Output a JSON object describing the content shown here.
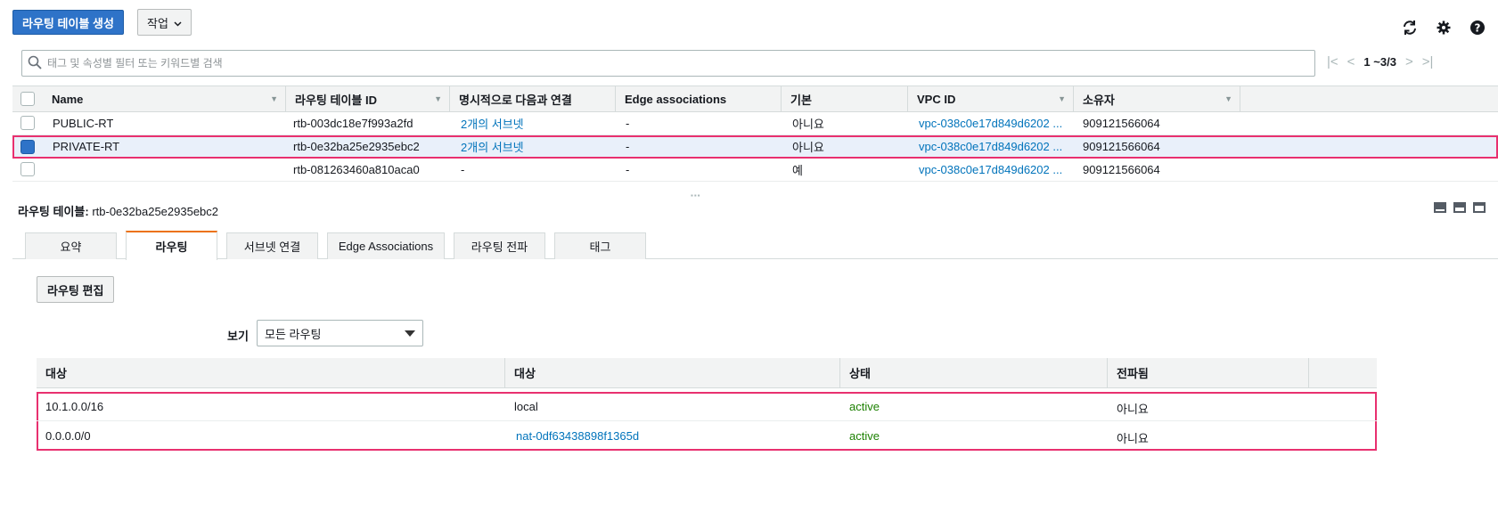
{
  "toolbar": {
    "create_label": "라우팅 테이블 생성",
    "actions_label": "작업"
  },
  "search": {
    "placeholder": "태그 및 속성별 필터 또는 키워드별 검색"
  },
  "pager": {
    "text": "1 ~3/3"
  },
  "route_tables": {
    "columns": [
      "Name",
      "라우팅 테이블 ID",
      "명시적으로 다음과 연결",
      "Edge associations",
      "기본",
      "VPC ID",
      "소유자"
    ],
    "rows": [
      {
        "name": "PUBLIC-RT",
        "id": "rtb-003dc18e7f993a2fd",
        "explicit": "2개의 서브넷",
        "edge": "-",
        "main": "아니요",
        "vpc": "vpc-038c0e17d849d6202 ...",
        "owner": "909121566064",
        "selected": false
      },
      {
        "name": "PRIVATE-RT",
        "id": "rtb-0e32ba25e2935ebc2",
        "explicit": "2개의 서브넷",
        "edge": "-",
        "main": "아니요",
        "vpc": "vpc-038c0e17d849d6202 ...",
        "owner": "909121566064",
        "selected": true
      },
      {
        "name": "",
        "id": "rtb-081263460a810aca0",
        "explicit": "-",
        "edge": "-",
        "main": "예",
        "vpc": "vpc-038c0e17d849d6202 ...",
        "owner": "909121566064",
        "selected": false
      }
    ]
  },
  "detail": {
    "label": "라우팅 테이블:",
    "id": "rtb-0e32ba25e2935ebc2"
  },
  "tabs": [
    "요약",
    "라우팅",
    "서브넷 연결",
    "Edge Associations",
    "라우팅 전파",
    "태그"
  ],
  "routes": {
    "edit_label": "라우팅 편집",
    "view_label": "보기",
    "view_value": "모든 라우팅",
    "columns": [
      "대상",
      "대상",
      "상태",
      "전파됨"
    ],
    "rows": [
      {
        "destination": "10.1.0.0/16",
        "target": "local",
        "status": "active",
        "propagated": "아니요"
      },
      {
        "destination": "0.0.0.0/0",
        "target": "nat-0df63438898f1365d",
        "status": "active",
        "propagated": "아니요"
      }
    ]
  },
  "colors": {
    "primary": "#2e73c8",
    "link": "#0073bb",
    "active": "#1d8102",
    "highlight": "#e8306f",
    "tab_accent": "#ec7211"
  }
}
